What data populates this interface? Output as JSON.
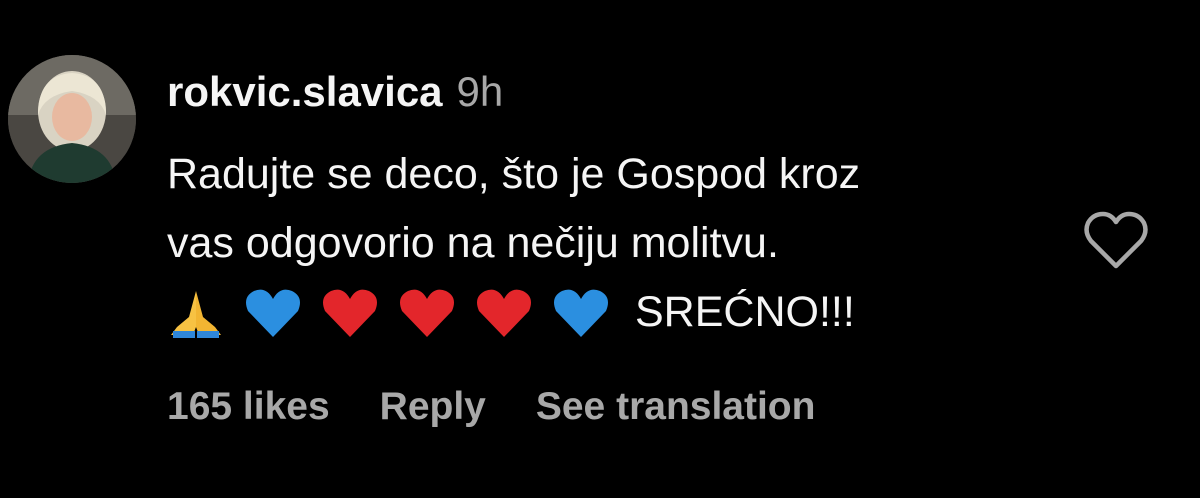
{
  "comment": {
    "username": "rokvic.slavica",
    "timestamp": "9h",
    "text_lines": [
      "Radujte se deco, što je Gospod kroz",
      "vas odgovorio na nečiju molitvu."
    ],
    "emojis": [
      "folded-hands",
      "blue-heart",
      "red-heart",
      "red-heart",
      "red-heart",
      "blue-heart"
    ],
    "closing_text": "SREĆNO!!!",
    "likes_label": "165 likes",
    "reply_label": "Reply",
    "translation_label": "See translation"
  },
  "colors": {
    "background": "#000000",
    "primary_text": "#f5f5f5",
    "secondary_text": "#a8a8a8",
    "red_heart": "#e3262b",
    "blue_heart": "#2b8fe0"
  }
}
